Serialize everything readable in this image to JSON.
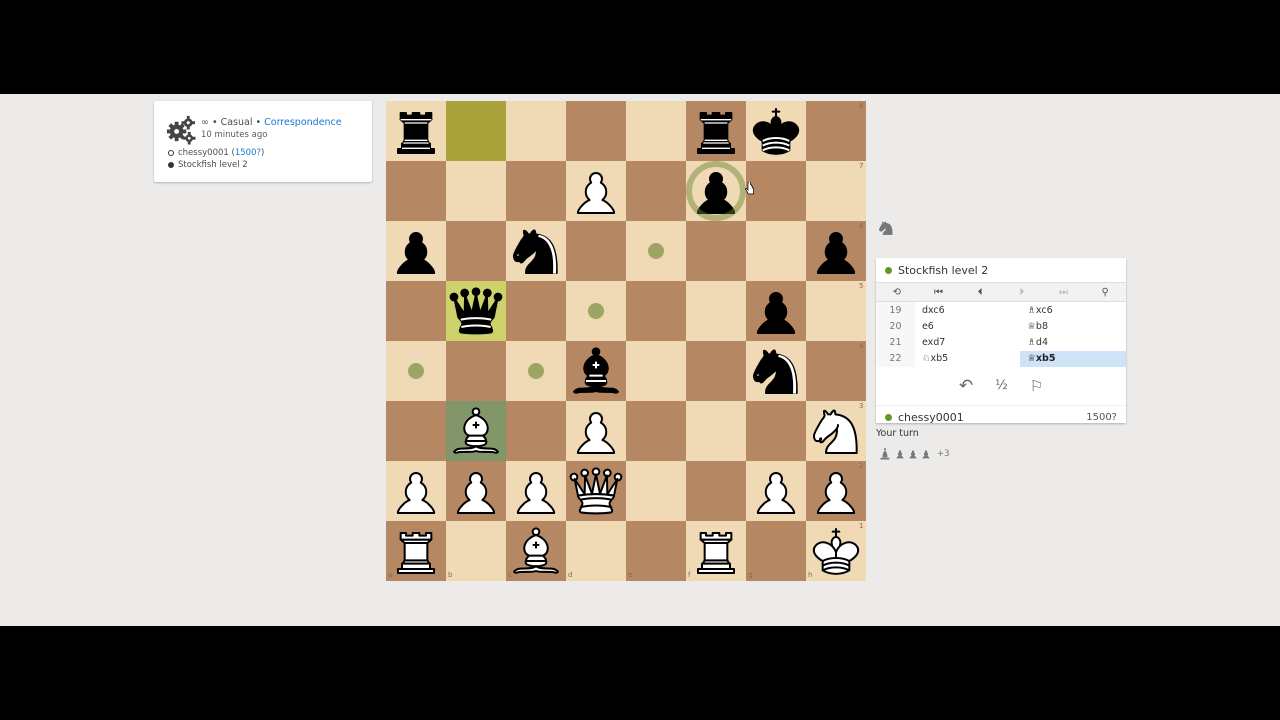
{
  "game_info": {
    "time_control": "∞",
    "separator": " • ",
    "mode": "Casual",
    "speed": "Correspondence",
    "age": "10 minutes ago",
    "white_player": "chessy0001",
    "white_rating": "1500?",
    "black_player": "Stockfish level 2"
  },
  "board": {
    "files": [
      "a",
      "b",
      "c",
      "d",
      "e",
      "f",
      "g",
      "h"
    ],
    "ranks": [
      "8",
      "7",
      "6",
      "5",
      "4",
      "3",
      "2",
      "1"
    ],
    "rows": [
      [
        "bR",
        "",
        "",
        "",
        "",
        "bR",
        "bK",
        ""
      ],
      [
        "",
        "",
        "",
        "wP",
        "",
        "bP",
        "",
        ""
      ],
      [
        "bP",
        "",
        "bN",
        "",
        "",
        "",
        "",
        "bP"
      ],
      [
        "",
        "bQ",
        "",
        "",
        "",
        "",
        "bP",
        ""
      ],
      [
        "",
        "",
        "",
        "bB",
        "",
        "",
        "bN",
        ""
      ],
      [
        "",
        "wB",
        "",
        "wP",
        "",
        "",
        "",
        "wN"
      ],
      [
        "wP",
        "wP",
        "wP",
        "wQ",
        "",
        "",
        "wP",
        "wP"
      ],
      [
        "wR",
        "",
        "wB",
        "",
        "",
        "wR",
        "",
        "wK"
      ]
    ],
    "last_move_from": "b8",
    "last_move_to": "b5",
    "selected": "b3",
    "move_dests": [
      "e6",
      "d5",
      "a4",
      "c4"
    ],
    "capture_dests": [
      "f7"
    ]
  },
  "opponent_panel": {
    "name": "Stockfish level 2"
  },
  "controls": {
    "flip": "⟲",
    "first": "⏮",
    "prev": "⏴",
    "next": "⏵",
    "last": "⏭",
    "analysis": "⚲"
  },
  "move_list": [
    {
      "num": "19",
      "white": "dxc6",
      "black": "♗xc6"
    },
    {
      "num": "20",
      "white": "e6",
      "black": "♕b8"
    },
    {
      "num": "21",
      "white": "exd7",
      "black": "♗d4"
    },
    {
      "num": "22",
      "white": "♘xb5",
      "black": "♕xb5"
    }
  ],
  "actions": {
    "takeback": "↶",
    "draw": "½",
    "resign": "⚐"
  },
  "me_panel": {
    "name": "chessy0001",
    "rating": "1500?"
  },
  "status": {
    "your_turn": "Your turn",
    "material_diff": "+3"
  },
  "colors": {
    "light_square": "#f0d9b5",
    "dark_square": "#b58863",
    "link": "#1b78d0",
    "online": "#629924"
  }
}
